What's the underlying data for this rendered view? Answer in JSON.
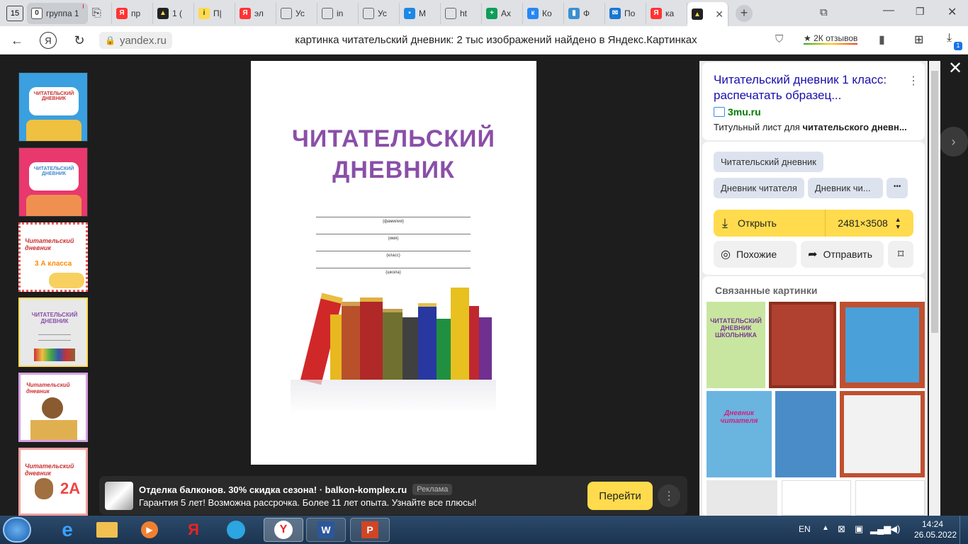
{
  "tabs": {
    "counter": "15",
    "group_count": "0",
    "group_label": "группа 1",
    "items": [
      "пр",
      "1 (",
      "П|",
      "эл",
      "Ус",
      "in",
      "Ус",
      "М",
      "ht",
      "Ах",
      "Ко",
      "Ф",
      "По",
      "ка"
    ]
  },
  "address": {
    "domain": "yandex.ru",
    "page_title": "картинка читательский дневник: 2 тыс изображений найдено в Яндекс.Картинках",
    "reviews": "2К отзывов",
    "downloads_badge": "1",
    "ext_badge": "1"
  },
  "document": {
    "title_line1": "ЧИТАТЕЛЬСКИЙ",
    "title_line2": "ДНЕВНИК",
    "fields": [
      "(фамилия)",
      "(имя)",
      "(класс)",
      "(школа)"
    ]
  },
  "thumbs": [
    {
      "title": "ЧИТАТЕЛЬСКИЙ ДНЕВНИК",
      "bg": "#3aa0e0"
    },
    {
      "title": "ЧИТАТЕЛЬСКИЙ ДНЕВНИК",
      "bg": "#e8386e"
    },
    {
      "title": "Читательский дневник",
      "sub": "3 А класса",
      "bg": "#ffffff"
    },
    {
      "title": "ЧИТАТЕЛЬСКИЙ ДНЕВНИК",
      "bg": "#e8e8e8"
    },
    {
      "title": "Читательский дневник",
      "bg": "#ffffff"
    },
    {
      "title": "Читательский дневник",
      "sub": "2А",
      "bg": "#ffffff"
    }
  ],
  "panel": {
    "result_title": "Читательский дневник 1 класс: распечатать образец...",
    "source": "3mu.ru",
    "snippet_prefix": "Титульный лист для ",
    "snippet_bold": "читательского дневн...",
    "tags": [
      "Читательский дневник",
      "Дневник читателя",
      "Дневник чи..."
    ],
    "more_tags": "•••",
    "open_label": "Открыть",
    "size": "2481×3508",
    "similar_label": "Похожие",
    "share_label": "Отправить",
    "related_title": "Связанные картинки",
    "related": [
      {
        "text": "ЧИТАТЕЛЬСКИЙ ДНЕВНИК ШКОЛЬНИКА",
        "bg": "#c8e6a0"
      },
      {
        "text": "",
        "bg": "#b04030"
      },
      {
        "text": "",
        "bg": "#4aa0d8"
      },
      {
        "text": "Дневник читателя",
        "bg": "#6ab4e0"
      },
      {
        "text": "",
        "bg": "#4a8cc8"
      },
      {
        "text": "",
        "bg": "#f2f2f2"
      },
      {
        "text": "",
        "bg": "#e8e8e8"
      },
      {
        "text": "",
        "bg": "#ffffff"
      },
      {
        "text": "",
        "bg": "#ffffff"
      }
    ]
  },
  "ad": {
    "headline": "Отделка балконов. 30% скидка сезона! · balkon-komplex.ru",
    "badge": "Реклама",
    "text": "Гарантия 5 лет! Возможна рассрочка. Более 11 лет опыта. Узнайте все плюсы!",
    "cta": "Перейти"
  },
  "taskbar": {
    "lang": "EN",
    "time": "14:24",
    "date": "26.05.2022"
  },
  "colors": {
    "accent": "#ffdb4d",
    "link": "#1a0dab",
    "doc_title": "#8a4fa8",
    "source_green": "#007a00"
  }
}
